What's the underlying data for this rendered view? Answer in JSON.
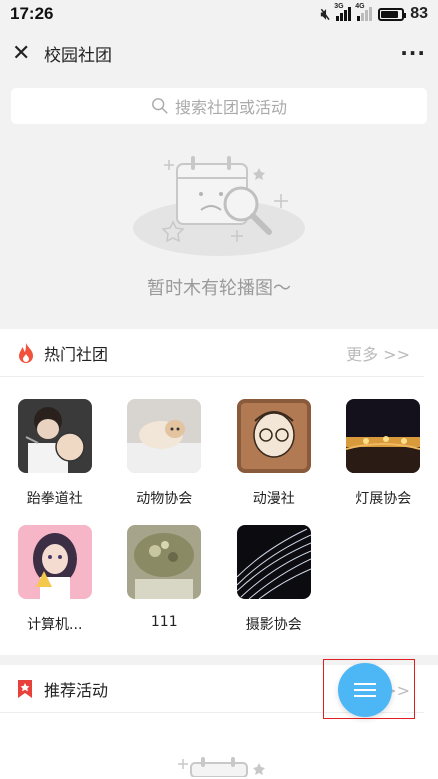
{
  "status_bar": {
    "time": "17:26",
    "net1": "3G",
    "net2": "4G",
    "battery": "83",
    "battery_level": 0.83
  },
  "nav": {
    "title": "校园社团",
    "close_glyph": "✕",
    "more_glyph": "···"
  },
  "search": {
    "placeholder": "搜索社团或活动"
  },
  "banner": {
    "empty_text": "暂时木有轮播图～"
  },
  "hot_clubs": {
    "title": "热门社团",
    "more": "更多 >>",
    "items": [
      {
        "name": "跆拳道社"
      },
      {
        "name": "动物协会"
      },
      {
        "name": "动漫社"
      },
      {
        "name": "灯展协会"
      },
      {
        "name": "计算机..."
      },
      {
        "name": "111"
      },
      {
        "name": "摄影协会"
      }
    ]
  },
  "recommended": {
    "title": "推荐活动",
    "more": "更多 >>"
  },
  "colors": {
    "accent": "#4db6f5",
    "hot_icon": "#f0523c",
    "mark_icon": "#e8403a",
    "highlight": "#e02020"
  }
}
